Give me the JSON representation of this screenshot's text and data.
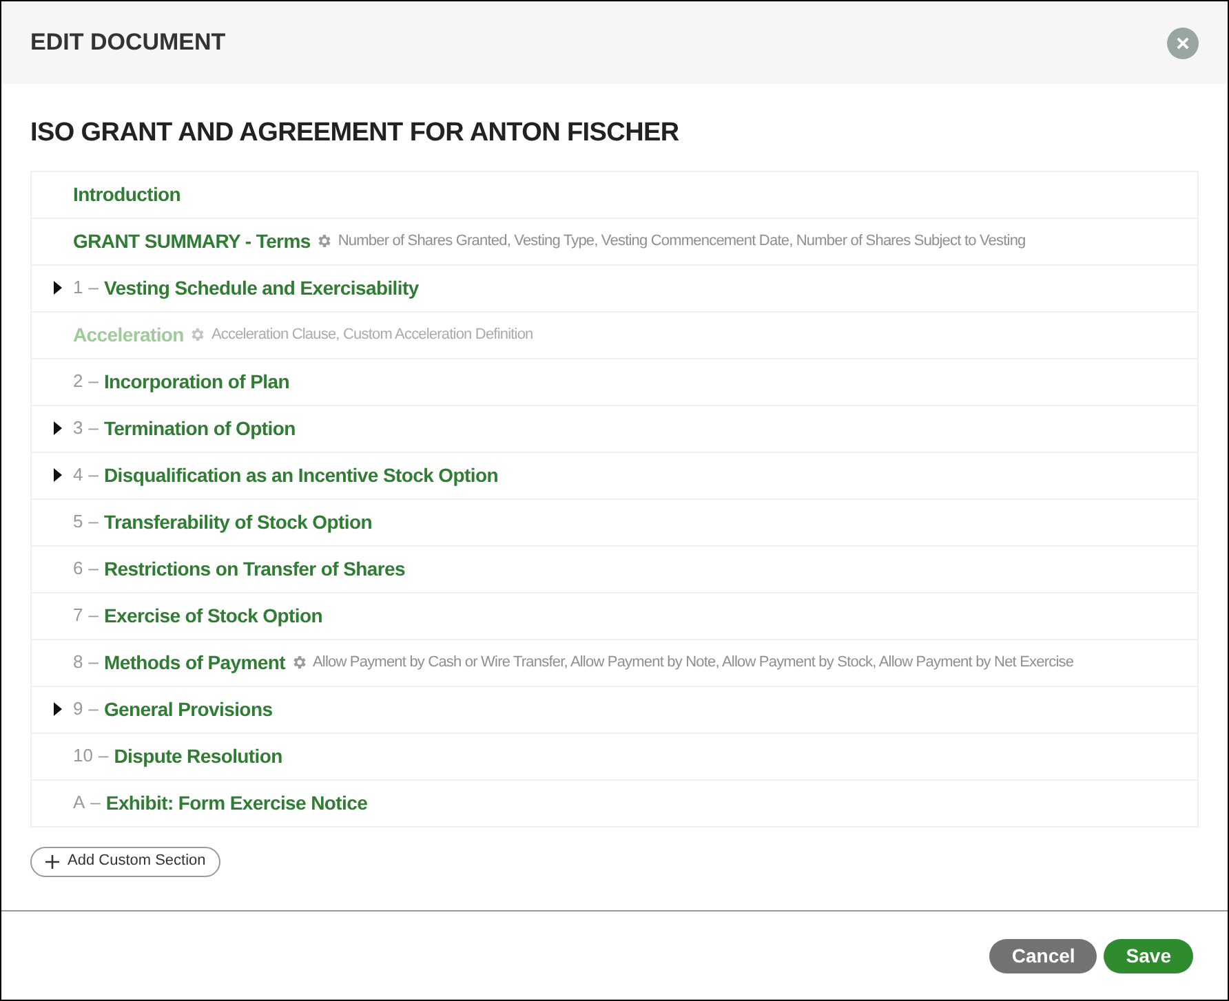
{
  "dialog": {
    "title": "EDIT DOCUMENT"
  },
  "document": {
    "title": "ISO GRANT AND AGREEMENT FOR ANTON FISCHER"
  },
  "sections": [
    {
      "title": "Introduction",
      "collapsible": false,
      "disabled": false
    },
    {
      "title": "GRANT SUMMARY - Terms",
      "settings": "Number of Shares Granted, Vesting Type, Vesting Commencement Date, Number of Shares Subject to Vesting",
      "collapsible": false,
      "disabled": false
    },
    {
      "number": "1",
      "separator": "–",
      "title": "Vesting Schedule and Exercisability",
      "collapsible": true,
      "disabled": false
    },
    {
      "title": "Acceleration",
      "settings": "Acceleration Clause, Custom Acceleration Definition",
      "collapsible": false,
      "disabled": true
    },
    {
      "number": "2",
      "separator": "–",
      "title": "Incorporation of Plan",
      "collapsible": false,
      "disabled": false
    },
    {
      "number": "3",
      "separator": "–",
      "title": "Termination of Option",
      "collapsible": true,
      "disabled": false
    },
    {
      "number": "4",
      "separator": "–",
      "title": "Disqualification as an Incentive Stock Option",
      "collapsible": true,
      "disabled": false
    },
    {
      "number": "5",
      "separator": "–",
      "title": "Transferability of Stock Option",
      "collapsible": false,
      "disabled": false
    },
    {
      "number": "6",
      "separator": "–",
      "title": "Restrictions on Transfer of Shares",
      "collapsible": false,
      "disabled": false
    },
    {
      "number": "7",
      "separator": "–",
      "title": "Exercise of Stock Option",
      "collapsible": false,
      "disabled": false
    },
    {
      "number": "8",
      "separator": "–",
      "title": "Methods of Payment",
      "settings": "Allow Payment by Cash or Wire Transfer, Allow Payment by Note, Allow Payment by Stock, Allow Payment by Net Exercise",
      "collapsible": false,
      "disabled": false
    },
    {
      "number": "9",
      "separator": "–",
      "title": "General Provisions",
      "collapsible": true,
      "disabled": false
    },
    {
      "number": "10",
      "separator": "–",
      "title": "Dispute Resolution",
      "collapsible": false,
      "disabled": false
    },
    {
      "number": "A",
      "separator": "–",
      "title": "Exhibit: Form Exercise Notice",
      "collapsible": false,
      "disabled": false
    }
  ],
  "add_button": "Add Custom Section",
  "buttons": {
    "cancel": "Cancel",
    "save": "Save"
  }
}
